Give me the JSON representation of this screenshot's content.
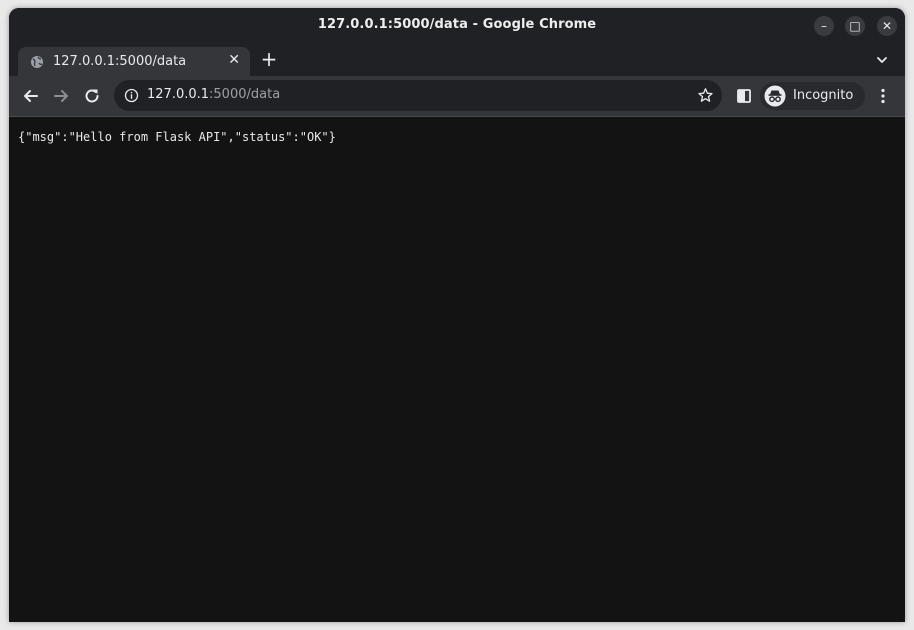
{
  "window": {
    "title": "127.0.0.1:5000/data - Google Chrome",
    "controls": {
      "minimize_glyph": "–",
      "maximize_glyph": "□",
      "close_glyph": "✕"
    }
  },
  "tabs": [
    {
      "title": "127.0.0.1:5000/data",
      "icon": "globe-icon",
      "close_glyph": "✕"
    }
  ],
  "new_tab_glyph": "+",
  "toolbar": {
    "back_icon": "back-arrow-icon",
    "forward_icon": "forward-arrow-icon",
    "reload_icon": "reload-icon",
    "url_host": "127.0.0.1",
    "url_path": ":5000/data",
    "bookmark_icon": "star-icon",
    "side_panel_icon": "side-panel-icon",
    "profile_label": "Incognito",
    "menu_icon": "kebab-menu-icon"
  },
  "page": {
    "body_text": "{\"msg\":\"Hello from Flask API\",\"status\":\"OK\"}"
  },
  "colors": {
    "frame": "#202124",
    "toolbar": "#35363a",
    "omnibox": "#202124",
    "page_background": "#131313",
    "text": "#e8eaed"
  }
}
